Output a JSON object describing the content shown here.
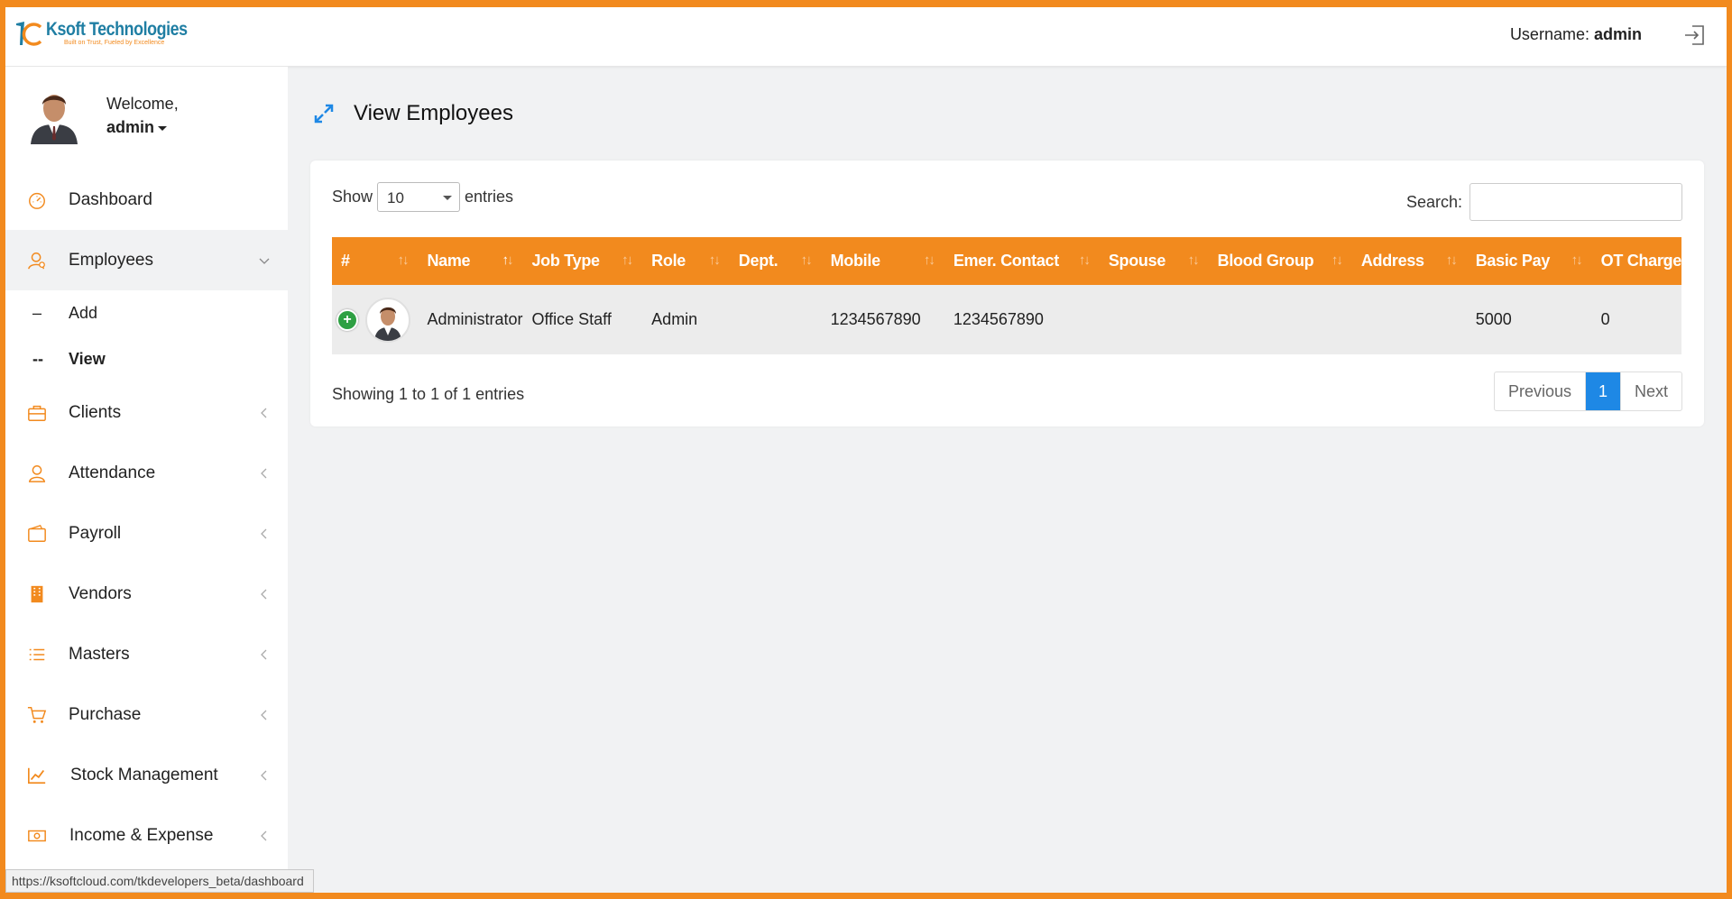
{
  "brand": {
    "name": "Ksoft Technologies",
    "tagline": "Built on Trust, Fueled by Excellence"
  },
  "header": {
    "username_label": "Username:",
    "username": "admin"
  },
  "sidebar": {
    "welcome": "Welcome,",
    "user": "admin",
    "items": [
      {
        "label": "Dashboard",
        "icon": "dashboard-icon"
      },
      {
        "label": "Employees",
        "icon": "employee-icon"
      },
      {
        "label": "Clients",
        "icon": "briefcase-icon"
      },
      {
        "label": "Attendance",
        "icon": "user-icon"
      },
      {
        "label": "Payroll",
        "icon": "wallet-icon"
      },
      {
        "label": "Vendors",
        "icon": "building-icon"
      },
      {
        "label": "Masters",
        "icon": "list-icon"
      },
      {
        "label": "Purchase",
        "icon": "cart-icon"
      },
      {
        "label": "Stock Management",
        "icon": "chart-line-icon"
      },
      {
        "label": "Income & Expense",
        "icon": "money-icon"
      }
    ],
    "employee_sub": [
      {
        "dash": "–",
        "label": "Add"
      },
      {
        "dash": "--",
        "label": "View"
      }
    ]
  },
  "main": {
    "title": "View Employees",
    "show_label": "Show",
    "entries_value": "10",
    "entries_label": "entries",
    "search_label": "Search:",
    "search_value": "",
    "columns": [
      "#",
      "Name",
      "Job Type",
      "Role",
      "Dept.",
      "Mobile",
      "Emer. Contact",
      "Spouse",
      "Blood Group",
      "Address",
      "Basic Pay",
      "OT Charge"
    ],
    "rows": [
      {
        "name": "Administrator",
        "job_type": "Office Staff",
        "role": "Admin",
        "dept": "",
        "mobile": "1234567890",
        "emer_contact": "1234567890",
        "spouse": "",
        "blood_group": "",
        "address": "",
        "basic_pay": "5000",
        "ot_charge": "0"
      }
    ],
    "info": "Showing 1 to 1 of 1 entries",
    "pager": {
      "previous": "Previous",
      "current": "1",
      "next": "Next"
    },
    "expand_symbol": "+"
  },
  "status_url": "https://ksoftcloud.com/tkdevelopers_beta/dashboard",
  "colors": {
    "accent": "#f28a1e",
    "brand_blue": "#1f7ea3",
    "link_blue": "#1e88e5",
    "add_green": "#2ea043"
  }
}
